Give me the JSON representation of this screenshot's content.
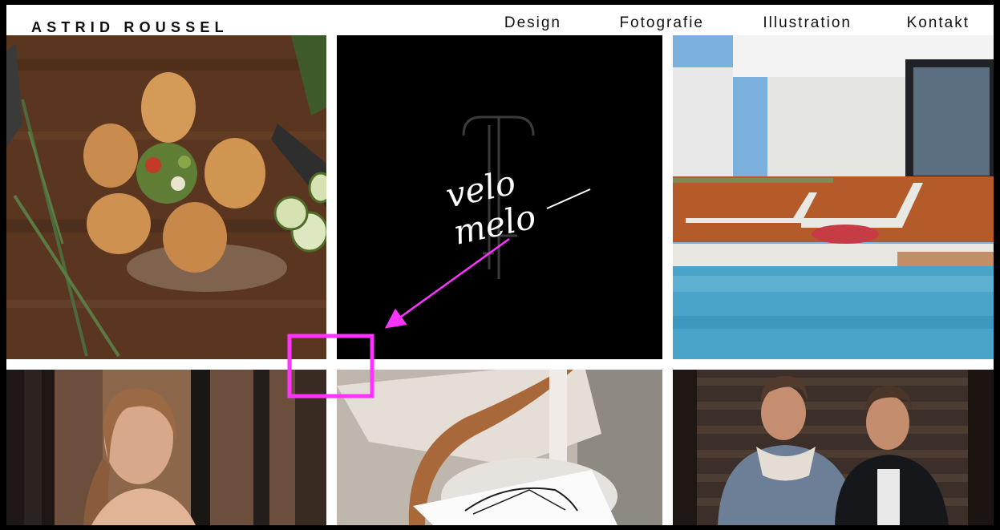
{
  "brand": {
    "name": "ASTRID ROUSSEL"
  },
  "nav": {
    "items": [
      {
        "label": "Design"
      },
      {
        "label": "Fotografie"
      },
      {
        "label": "Illustration"
      },
      {
        "label": "Kontakt"
      }
    ]
  },
  "gallery": {
    "logo_line1": "velo",
    "logo_line2": "melo"
  },
  "colors": {
    "annotation": "#ff33ff",
    "page_bg": "#ffffff",
    "frame": "#000000"
  }
}
